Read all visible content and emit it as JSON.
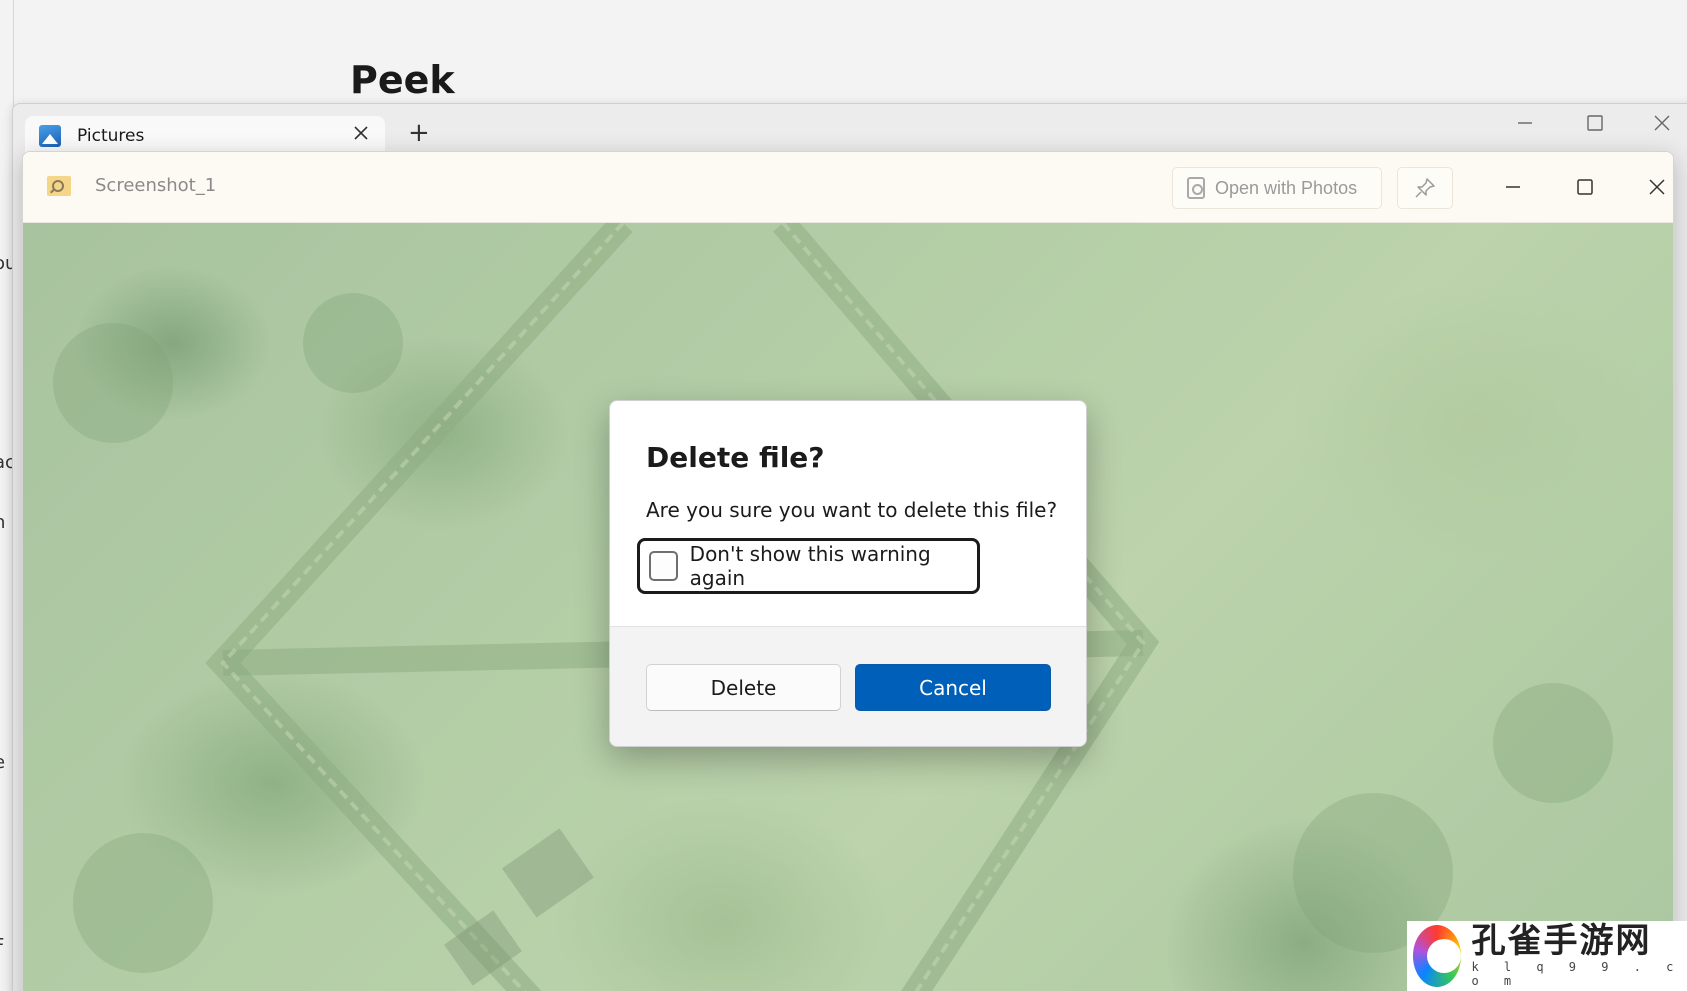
{
  "background_page": {
    "title": "Peek",
    "side_fragments": [
      "ou",
      "ac",
      "n",
      "-",
      "e",
      "F"
    ]
  },
  "explorer": {
    "tab_label": "Pictures",
    "tab_icon": "image-icon",
    "close_tab_icon": "close-icon",
    "new_tab_label": "+",
    "controls": {
      "minimize": "minimize-icon",
      "maximize": "maximize-icon",
      "close": "close-icon"
    }
  },
  "peek": {
    "filename": "Screenshot_1",
    "open_with_label": "Open with Photos",
    "pin_icon": "pin-icon",
    "controls": {
      "minimize": "minimize-icon",
      "maximize": "maximize-icon",
      "close": "close-icon"
    }
  },
  "dialog": {
    "title": "Delete file?",
    "message": "Are you sure you want to delete this file?",
    "checkbox_label": "Don't show this warning again",
    "checkbox_checked": false,
    "delete_label": "Delete",
    "cancel_label": "Cancel",
    "accent_color": "#005fb8"
  },
  "watermark": {
    "title": "孔雀手游网",
    "subtitle": "k l q 9 9 . c o m"
  }
}
